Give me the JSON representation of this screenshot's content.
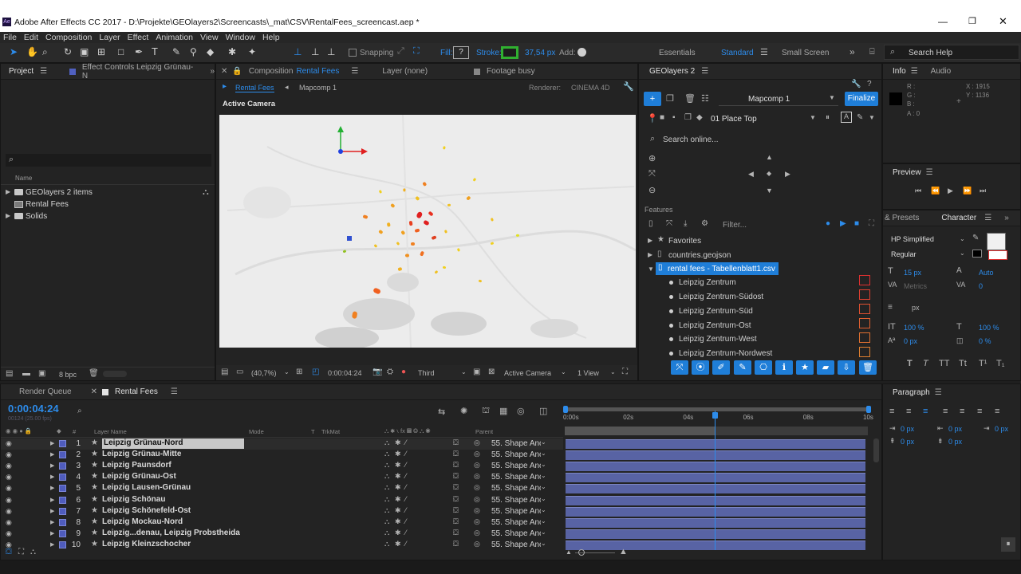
{
  "window": {
    "title": "Adobe After Effects CC 2017 - D:\\Projekte\\GEOlayers2\\Screencasts\\_mat\\CSV\\RentalFees_screencast.aep *",
    "app_icon": "Ae"
  },
  "menu": [
    "File",
    "Edit",
    "Composition",
    "Layer",
    "Effect",
    "Animation",
    "View",
    "Window",
    "Help"
  ],
  "toolbar": {
    "snapping": "Snapping",
    "fill": "Fill:",
    "fill_value": "?",
    "stroke": "Stroke:",
    "stroke_width": "37,54 px",
    "add": "Add:",
    "workspaces": [
      "Essentials",
      "Standard",
      "Small Screen"
    ],
    "search_placeholder": "Search Help"
  },
  "project": {
    "tab": "Project",
    "effect_tab": "Effect Controls Leipzig Grünau-N",
    "search_icon": "⌕",
    "column_name": "Name",
    "items": [
      {
        "name": "GEOlayers 2 items",
        "type": "folder"
      },
      {
        "name": "Rental Fees",
        "type": "comp"
      },
      {
        "name": "Solids",
        "type": "folder"
      }
    ],
    "bpc": "8 bpc"
  },
  "composition": {
    "tab_prefix": "Composition",
    "tab_name": "Rental Fees",
    "layer_tab": "Layer (none)",
    "footage_tab": "Footage busy",
    "sub_tabs": [
      "Rental Fees",
      "Mapcomp 1"
    ],
    "renderer_label": "Renderer:",
    "renderer": "CINEMA 4D",
    "view_label": "Active Camera",
    "zoom": "(40,7%)",
    "timecode": "0:00:04:24",
    "resolution": "Third",
    "camera": "Active Camera",
    "views": "1 View"
  },
  "geolayers": {
    "tab": "GEOlayers 2",
    "mapcomp": "Mapcomp 1",
    "finalize": "Finalize",
    "style": "01 Place Top",
    "search_placeholder": "Search online...",
    "features_label": "Features",
    "filter_placeholder": "Filter...",
    "tree": [
      {
        "label": "Favorites",
        "level": 0
      },
      {
        "label": "countries.geojson",
        "level": 0
      },
      {
        "label": "rental fees - Tabellenblatt1.csv",
        "level": 0,
        "selected": true
      },
      {
        "label": "Leipzig Zentrum",
        "level": 1
      },
      {
        "label": "Leipzig Zentrum-Südost",
        "level": 1
      },
      {
        "label": "Leipzig Zentrum-Süd",
        "level": 1
      },
      {
        "label": "Leipzig Zentrum-Ost",
        "level": 1
      },
      {
        "label": "Leipzig Zentrum-West",
        "level": 1
      },
      {
        "label": "Leipzig Zentrum-Nordwest",
        "level": 1
      }
    ]
  },
  "info": {
    "tab": "Info",
    "audio_tab": "Audio",
    "r": "R :",
    "g": "G :",
    "b": "B :",
    "a": "A : 0",
    "x": "X : 1915",
    "y": "Y : 1136"
  },
  "preview": {
    "tab": "Preview"
  },
  "character": {
    "presets_tab": "& Presets",
    "tab": "Character",
    "font": "HP Simplified",
    "style": "Regular",
    "size": "15 px",
    "leading": "Auto",
    "kerning": "Metrics",
    "tracking": "0",
    "stroke_unit": "px",
    "vscale": "100 %",
    "hscale": "100 %",
    "baseline": "0 px",
    "tsume": "0 %",
    "styles": [
      "T",
      "T",
      "TT",
      "Tt",
      "T¹",
      "T₁"
    ]
  },
  "paragraph": {
    "tab": "Paragraph",
    "indent": [
      "0 px",
      "0 px",
      "0 px",
      "0 px",
      "0 px"
    ]
  },
  "timeline": {
    "render_queue": "Render Queue",
    "tab": "Rental Fees",
    "timecode": "0:00:04:24",
    "timecode_sub": "00124 (25.00 fps)",
    "columns": {
      "num": "#",
      "name": "Layer Name",
      "mode": "Mode",
      "t": "T",
      "trkmat": "TrkMat",
      "parent": "Parent"
    },
    "ruler": [
      "0:00s",
      "02s",
      "04s",
      "06s",
      "08s",
      "10s"
    ],
    "playhead_fraction": 0.497,
    "layers": [
      {
        "num": "1",
        "name": "Leipzig Grünau-Nord",
        "parent": "55. Shape Anc"
      },
      {
        "num": "2",
        "name": "Leipzig Grünau-Mitte",
        "parent": "55. Shape Anc"
      },
      {
        "num": "3",
        "name": "Leipzig Paunsdorf",
        "parent": "55. Shape Anc"
      },
      {
        "num": "4",
        "name": "Leipzig Grünau-Ost",
        "parent": "55. Shape Anc"
      },
      {
        "num": "5",
        "name": "Leipzig Lausen-Grünau",
        "parent": "55. Shape Anc"
      },
      {
        "num": "6",
        "name": "Leipzig Schönau",
        "parent": "55. Shape Anc"
      },
      {
        "num": "7",
        "name": "Leipzig Schönefeld-Ost",
        "parent": "55. Shape Anc"
      },
      {
        "num": "8",
        "name": "Leipzig Mockau-Nord",
        "parent": "55. Shape Anc"
      },
      {
        "num": "9",
        "name": "Leipzig...denau, Leipzig Probstheida",
        "parent": "55. Shape Anc"
      },
      {
        "num": "10",
        "name": "Leipzig Kleinzschocher",
        "parent": "55. Shape Anc"
      }
    ]
  },
  "colors": {
    "accent": "#2d8ceb",
    "layer_bar": "#5863a4",
    "label": "#4f5cbd",
    "finalize": "#1f7ed8"
  }
}
